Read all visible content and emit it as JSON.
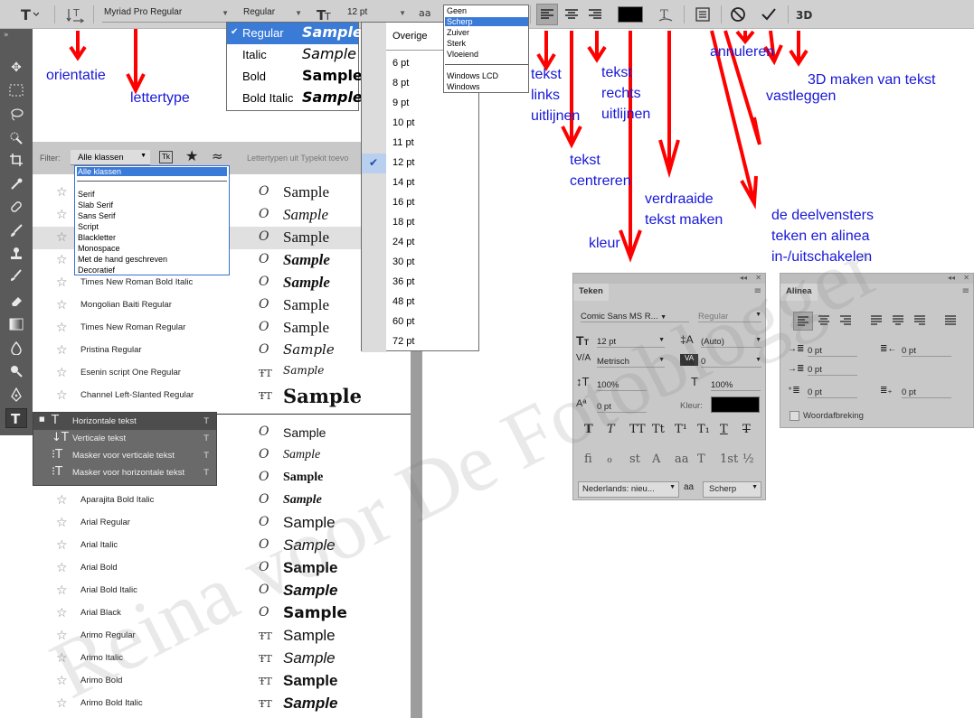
{
  "toolbar": {
    "font_family": "Myriad Pro Regular",
    "font_style": "Regular",
    "font_size": "12 pt",
    "antialias_icon": "aa",
    "orientation_icon": "text-orientation-icon",
    "color_swatch": "#000000"
  },
  "style_menu": {
    "items": [
      {
        "label": "Regular",
        "sample": "Sample",
        "checked": "✔"
      },
      {
        "label": "Italic",
        "sample": "Sample"
      },
      {
        "label": "Bold",
        "sample": "Sample"
      },
      {
        "label": "Bold Italic",
        "sample": "Sample"
      }
    ]
  },
  "size_menu": {
    "header": "Overige",
    "items": [
      "6 pt",
      "8 pt",
      "9 pt",
      "10 pt",
      "11 pt",
      "12 pt",
      "14 pt",
      "16 pt",
      "18 pt",
      "24 pt",
      "30 pt",
      "36 pt",
      "48 pt",
      "60 pt",
      "72 pt"
    ],
    "checked_mark": "✔"
  },
  "antialias_menu": {
    "items": [
      "Geen",
      "Scherp",
      "Zuiver",
      "Sterk",
      "Vloeiend"
    ],
    "items2": [
      "Windows LCD",
      "Windows"
    ]
  },
  "filter": {
    "label": "Filter:",
    "selected": "Alle klassen",
    "typekit_label": "Lettertypen uit Typekit toevo",
    "classes": [
      "Alle klassen",
      "Serif",
      "Slab Serif",
      "Sans Serif",
      "Script",
      "Blackletter",
      "Monospace",
      "Met de hand geschreven",
      "Decoratief"
    ]
  },
  "fonts_top": [
    {
      "name": "",
      "sample": "Sample"
    },
    {
      "name": "",
      "sample": "Sample"
    },
    {
      "name": "",
      "sample": "Sample"
    },
    {
      "name": "",
      "sample": "Sample"
    },
    {
      "name": "Times New Roman Bold Italic",
      "sample": "Sample"
    },
    {
      "name": "Mongolian Baiti Regular",
      "sample": "Sample"
    },
    {
      "name": "Times New Roman Regular",
      "sample": "Sample"
    },
    {
      "name": "Pristina Regular",
      "sample": "Sample"
    },
    {
      "name": "Esenin script One Regular",
      "sample": "Sample"
    },
    {
      "name": "Channel Left-Slanted Regular",
      "sample": "Sample"
    }
  ],
  "fonts_bottom": [
    {
      "name": "",
      "sample": "Sample"
    },
    {
      "name": "",
      "sample": "Sample"
    },
    {
      "name": "",
      "sample": "Sample"
    },
    {
      "name": "Aparajita Bold Italic",
      "sample": "Sample"
    },
    {
      "name": "Arial Regular",
      "sample": "Sample"
    },
    {
      "name": "Arial Italic",
      "sample": "Sample"
    },
    {
      "name": "Arial Bold",
      "sample": "Sample"
    },
    {
      "name": "Arial Bold Italic",
      "sample": "Sample"
    },
    {
      "name": "Arial Black",
      "sample": "Sample"
    },
    {
      "name": "Arimo Regular",
      "sample": "Sample"
    },
    {
      "name": "Arimo Italic",
      "sample": "Sample"
    },
    {
      "name": "Arimo Bold",
      "sample": "Sample"
    },
    {
      "name": "Arimo Bold Italic",
      "sample": "Sample"
    }
  ],
  "type_tools": {
    "items": [
      {
        "label": "Horizontale tekst",
        "shortcut": "T"
      },
      {
        "label": "Verticale tekst",
        "shortcut": "T"
      },
      {
        "label": "Masker voor verticale tekst",
        "shortcut": "T"
      },
      {
        "label": "Masker voor horizontale tekst",
        "shortcut": "T"
      }
    ]
  },
  "annotations": {
    "orientatie": "orientatie",
    "lettertype": "lettertype",
    "links": "tekst\nlinks\nuitlijnen",
    "centreren": "tekst\ncentreren",
    "rechts": "tekst\nrechts\nuitlijnen",
    "kleur": "kleur",
    "verdraaide": "verdraaide\ntekst maken",
    "annuleren": "annuleren",
    "vastleggen": "vastleggen",
    "drie_d": "3D maken van tekst",
    "deelvensters": "de deelvensters\nteken en alinea\nin-/uitschakelen"
  },
  "teken_panel": {
    "tab": "Teken",
    "font": "Comic Sans MS R...",
    "style": "Regular",
    "size": "12 pt",
    "leading": "(Auto)",
    "kerning": "Metrisch",
    "tracking": "0",
    "vscale": "100%",
    "hscale": "100%",
    "baseline": "0 pt",
    "color_label": "Kleur:",
    "language": "Nederlands: nieu...",
    "aa_label": "aa",
    "antialias": "Scherp",
    "fx_row1": [
      "T",
      "T",
      "TT",
      "Tt",
      "T¹",
      "T₁",
      "T",
      "T"
    ],
    "fx_row2": [
      "fi",
      "ℴ",
      "st",
      "A",
      "aa",
      "T",
      "1st",
      "½"
    ]
  },
  "alinea_panel": {
    "tab": "Alinea",
    "indent_left": "0 pt",
    "indent_right": "0 pt",
    "first_line": "0 pt",
    "space_before": "0 pt",
    "space_after": "0 pt",
    "hyphenate": "Woordafbreking"
  },
  "watermark": "Reina voor De Fotoblogger"
}
